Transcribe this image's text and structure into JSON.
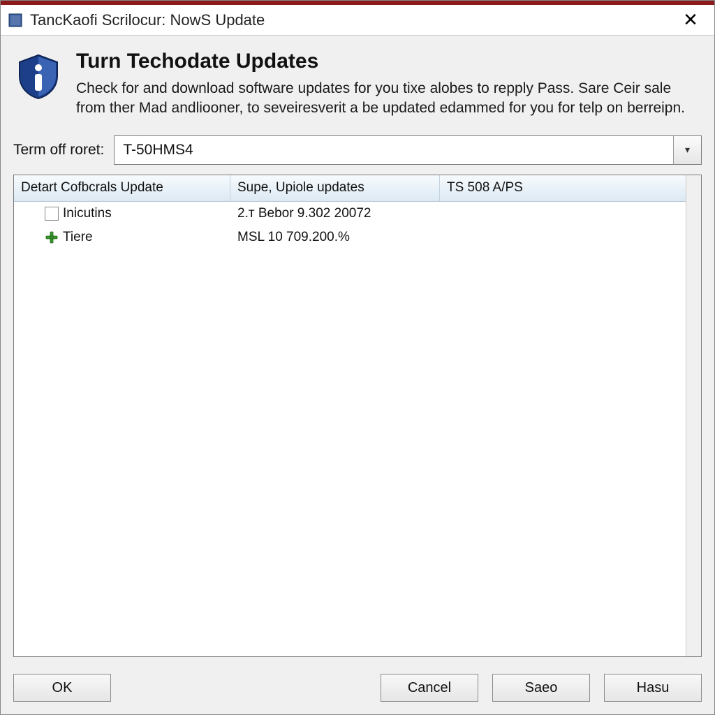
{
  "window": {
    "title": "TancKaofi Scrilocur: NowS Update"
  },
  "header": {
    "title": "Turn Techodate Updates",
    "description": "Check for and download software updates for you tixe alobes to repply Pass. Sare Ceir sale from ther Mad andliooner, to seveiresverit a be updated edammed for you for telp on berreipn."
  },
  "dropdown": {
    "label": "Term off roret:",
    "selected": "T-50HMS4"
  },
  "table": {
    "columns": {
      "c1": "Detart Cofbcrals Update",
      "c2": "Supe, Upiole updates",
      "c3": "TS 508 A/PS"
    },
    "rows": [
      {
        "icon": "checkbox",
        "name": "Inicutins",
        "c2": "2.т Bebor 9.302 20072",
        "c3": ""
      },
      {
        "icon": "plus",
        "name": "Tiere",
        "c2": "MSL 10 709.200.%",
        "c3": ""
      }
    ]
  },
  "buttons": {
    "ok": "OK",
    "cancel": "Cancel",
    "saeo": "Saeo",
    "hasu": "Hasu"
  }
}
